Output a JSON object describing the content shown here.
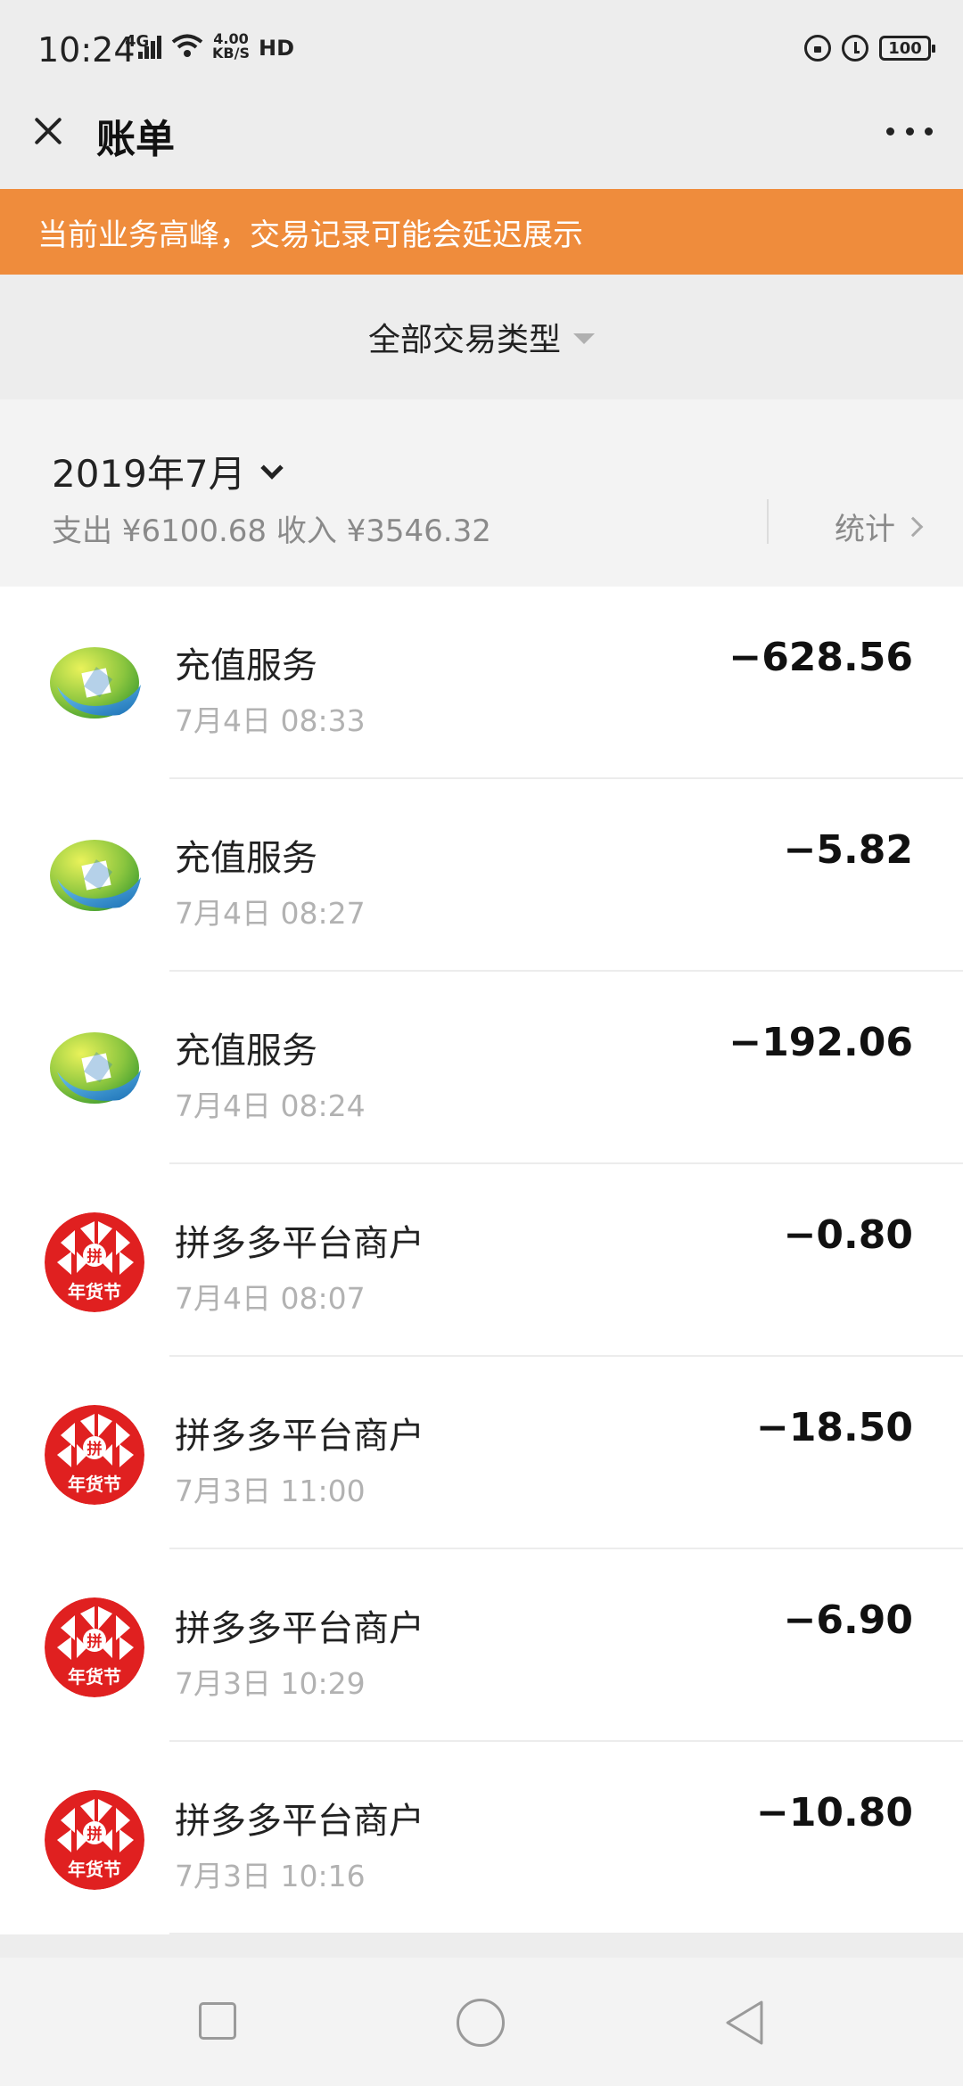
{
  "status_bar": {
    "time": "10:24",
    "signal": "4G",
    "speed": "4.00",
    "speed_unit": "KB/S",
    "hd": "HD",
    "battery": "100"
  },
  "nav": {
    "title": "账单"
  },
  "notice": {
    "text": "当前业务高峰，交易记录可能会延迟展示",
    "bg_color": "#ef8c3c"
  },
  "filter": {
    "label": "全部交易类型"
  },
  "month": {
    "title": "2019年7月",
    "summary": "支出 ¥6100.68 收入 ¥3546.32",
    "stats_label": "统计"
  },
  "transactions": [
    {
      "icon": "recharge-logo-icon",
      "title": "充值服务",
      "time": "7月4日 08:33",
      "amount": "−628.56"
    },
    {
      "icon": "recharge-logo-icon",
      "title": "充值服务",
      "time": "7月4日 08:27",
      "amount": "−5.82"
    },
    {
      "icon": "recharge-logo-icon",
      "title": "充值服务",
      "time": "7月4日 08:24",
      "amount": "−192.06"
    },
    {
      "icon": "pinduoduo-logo-icon",
      "title": "拼多多平台商户",
      "time": "7月4日 08:07",
      "amount": "−0.80"
    },
    {
      "icon": "pinduoduo-logo-icon",
      "title": "拼多多平台商户",
      "time": "7月3日 11:00",
      "amount": "−18.50"
    },
    {
      "icon": "pinduoduo-logo-icon",
      "title": "拼多多平台商户",
      "time": "7月3日 10:29",
      "amount": "−6.90"
    },
    {
      "icon": "pinduoduo-logo-icon",
      "title": "拼多多平台商户",
      "time": "7月3日 10:16",
      "amount": "−10.80"
    }
  ],
  "pdd_badge_text": "年货节",
  "pdd_badge_char": "拼"
}
